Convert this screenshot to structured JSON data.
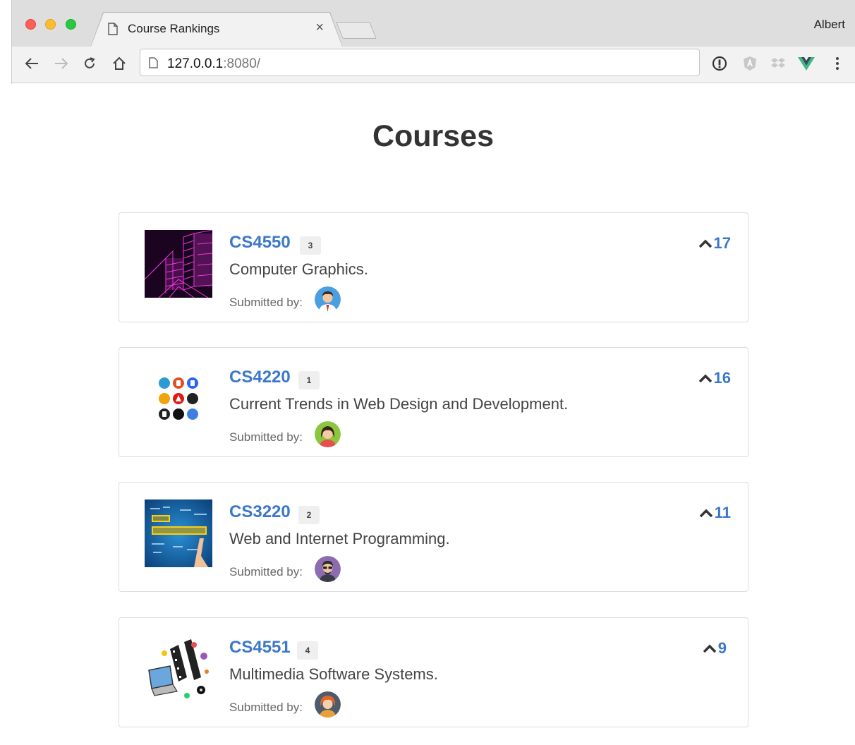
{
  "browser": {
    "tab_title": "Course Rankings",
    "tab_close": "×",
    "profile_name": "Albert",
    "url_host": "127.0.0.1",
    "url_port": ":8080/"
  },
  "page": {
    "title": "Courses"
  },
  "courses": [
    {
      "code": "CS4550",
      "rank": "3",
      "description": "Computer Graphics.",
      "submitted_label": "Submitted by:",
      "votes": "17",
      "thumb": "graphics-wireframe",
      "avatar": "man-tie-avatar"
    },
    {
      "code": "CS4220",
      "rank": "1",
      "description": "Current Trends in Web Design and Development.",
      "submitted_label": "Submitted by:",
      "votes": "16",
      "thumb": "web-tech-logos",
      "avatar": "woman-avatar"
    },
    {
      "code": "CS3220",
      "rank": "2",
      "description": "Web and Internet Programming.",
      "submitted_label": "Submitted by:",
      "votes": "11",
      "thumb": "web-development-wordcloud",
      "avatar": "man-glasses-avatar"
    },
    {
      "code": "CS4551",
      "rank": "4",
      "description": "Multimedia Software Systems.",
      "submitted_label": "Submitted by:",
      "votes": "9",
      "thumb": "multimedia-laptop",
      "avatar": "redhead-avatar"
    }
  ],
  "colors": {
    "link": "#3c78c8",
    "text": "#333333",
    "badge_bg": "#efefef"
  }
}
